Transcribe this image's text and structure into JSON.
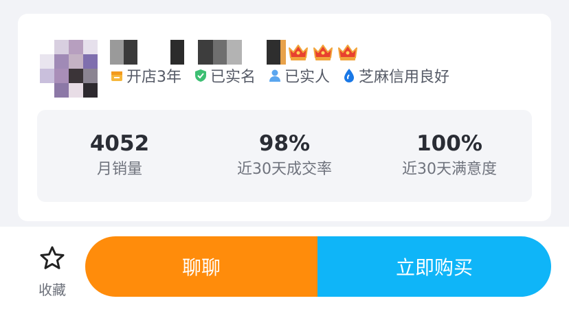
{
  "seller": {
    "crowns": 3,
    "badges": [
      {
        "icon": "shop-icon",
        "label": "开店3年"
      },
      {
        "icon": "verified-check-icon",
        "label": "已实名"
      },
      {
        "icon": "person-icon",
        "label": "已实人"
      },
      {
        "icon": "sesame-drop-icon",
        "label": "芝麻信用良好"
      }
    ]
  },
  "stats": [
    {
      "value": "4052",
      "label": "月销量"
    },
    {
      "value": "98%",
      "label": "近30天成交率"
    },
    {
      "value": "100%",
      "label": "近30天满意度"
    }
  ],
  "actions": {
    "favorite_label": "收藏",
    "chat_label": "聊聊",
    "buy_label": "立即购买"
  },
  "colors": {
    "chat_button": "#ff8c0b",
    "buy_button": "#0fb5f8",
    "crown": "#e8412e",
    "background": "#f2f3f7"
  }
}
